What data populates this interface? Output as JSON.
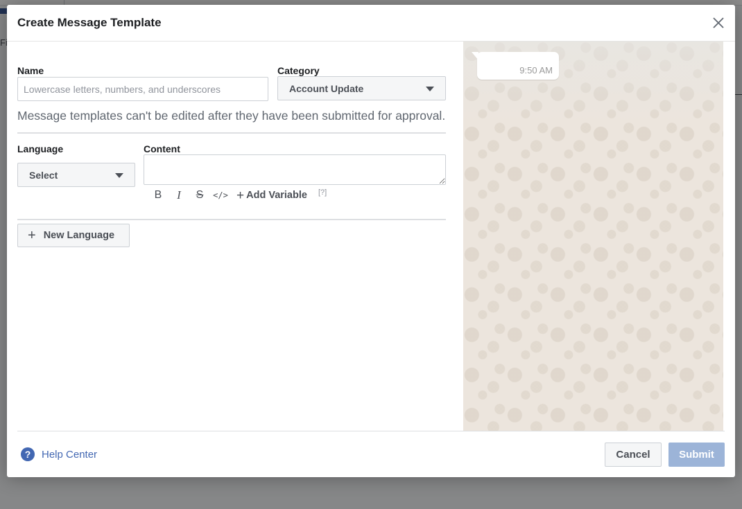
{
  "background": {
    "partial_text": "Fi"
  },
  "modal": {
    "title": "Create Message Template"
  },
  "form": {
    "name_label": "Name",
    "name_placeholder": "Lowercase letters, numbers, and underscores",
    "name_value": "",
    "category_label": "Category",
    "category_value": "Account Update",
    "notice": "Message templates can't be edited after they have been submitted for approval.",
    "language_label": "Language",
    "language_value": "Select",
    "content_label": "Content",
    "content_value": "",
    "toolbar": {
      "bold": "B",
      "italic": "I",
      "strike": "S",
      "code": "</>",
      "add_variable_plus": "+",
      "add_variable": "Add Variable",
      "help": "[?]"
    },
    "new_language_plus": "+",
    "new_language": "New Language"
  },
  "preview": {
    "time": "9:50 AM"
  },
  "footer": {
    "help_icon": "?",
    "help_label": "Help Center",
    "cancel": "Cancel",
    "submit": "Submit"
  },
  "colors": {
    "accent": "#4267b2",
    "submit_disabled": "#9cb4d8",
    "preview_bg": "#ece5dd"
  }
}
